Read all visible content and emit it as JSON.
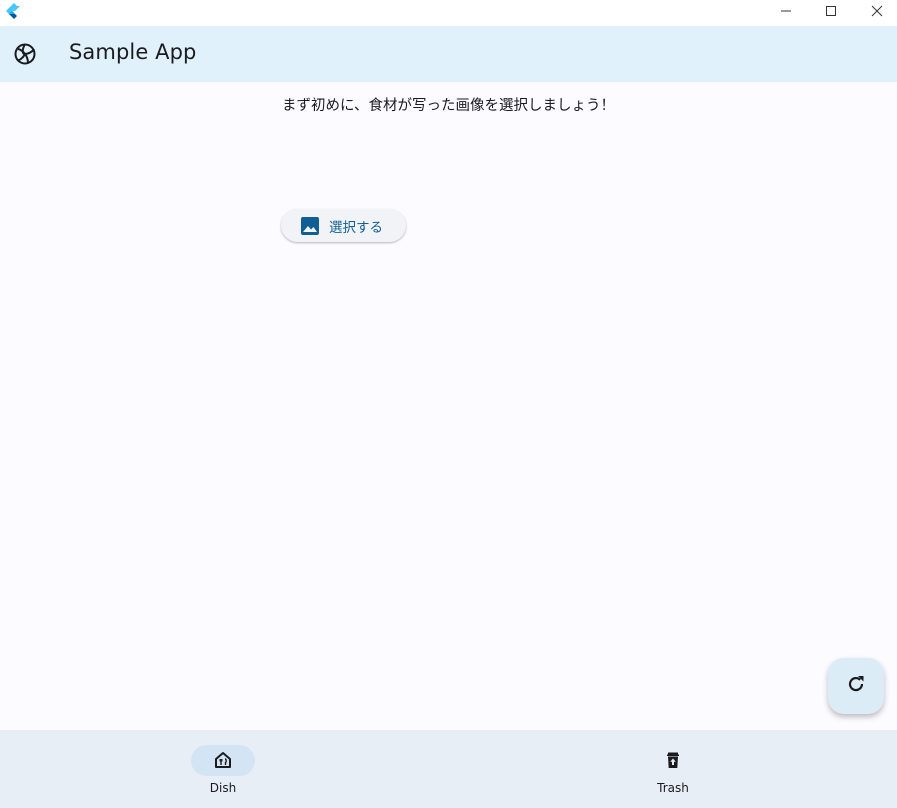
{
  "window": {
    "controls": [
      "minimize-icon",
      "maximize-icon",
      "close-icon"
    ]
  },
  "appbar": {
    "title": "Sample App",
    "logo_icon": "volleyball-icon"
  },
  "main": {
    "prompt": "まず初めに、食材が写った画像を選択しましょう！",
    "select_button": {
      "label": "選択する",
      "icon": "image-icon"
    },
    "fab_icon": "refresh-icon"
  },
  "bottom_nav": {
    "items": [
      {
        "label": "Dish",
        "icon": "dish-icon",
        "selected": true
      },
      {
        "label": "Trash",
        "icon": "trash-icon",
        "selected": false
      }
    ]
  },
  "colors": {
    "appbar_bg": "#e1f1fb",
    "accent": "#0f5e94",
    "nav_bg": "#e8eef5",
    "nav_selected_pill": "#d3e4f4"
  }
}
